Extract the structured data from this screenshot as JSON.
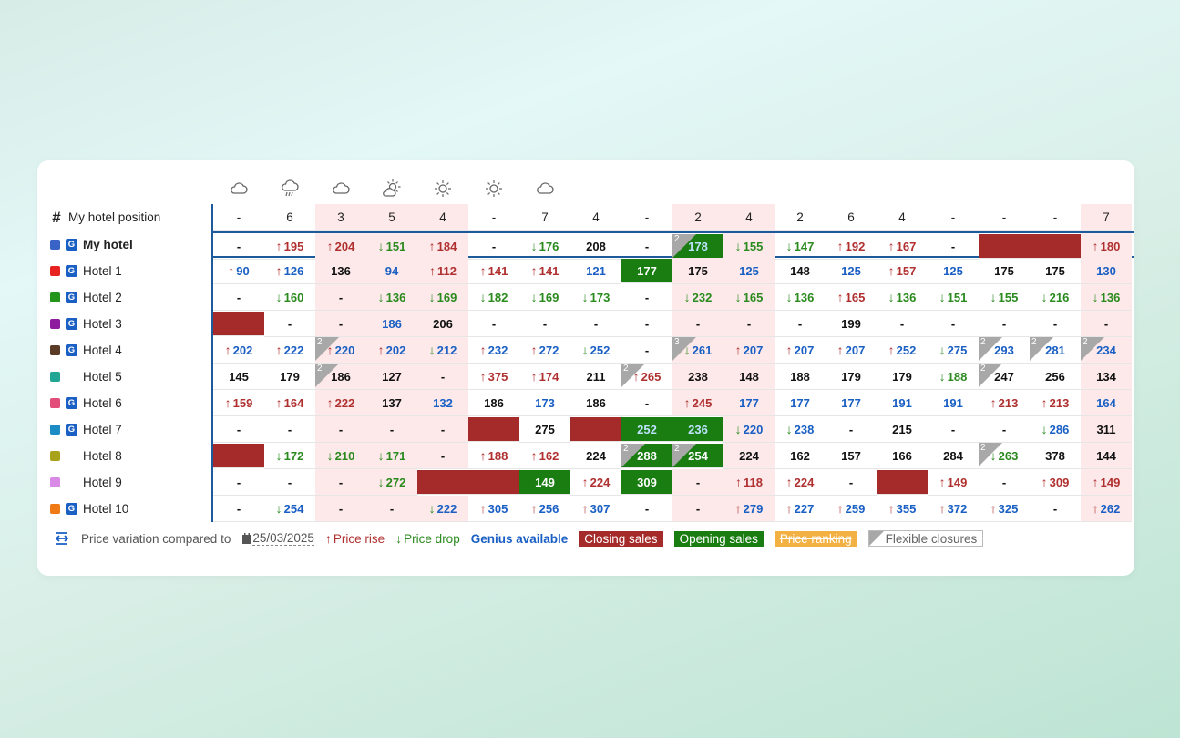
{
  "legend": {
    "compare_label": "Price variation compared to",
    "date": "25/03/2025",
    "rise": "Price rise",
    "drop": "Price drop",
    "genius": "Genius available",
    "closing": "Closing sales",
    "opening": "Opening sales",
    "ranking": "Price ranking",
    "flexible": "Flexible closures"
  },
  "colors": {
    "rise": "#b03030",
    "drop": "#2a8a1e",
    "genius": "#1a5fc4",
    "closing": "#a52a2a",
    "opening": "#1a7d12",
    "ranking": "#f3b143",
    "pink_column": "#fde9e9",
    "flexible": "#a8a8a8"
  },
  "weather": [
    "cloud-icon",
    "rain-icon",
    "cloud-icon",
    "sun-cloud-icon",
    "sun-icon",
    "sun-icon",
    "cloud-icon"
  ],
  "pink_columns": [
    2,
    3,
    4,
    9,
    10,
    17
  ],
  "position_row": {
    "label": "My hotel position",
    "values": [
      "-",
      "6",
      "3",
      "5",
      "4",
      "-",
      "7",
      "4",
      "-",
      "2",
      "4",
      "2",
      "6",
      "4",
      "-",
      "-",
      "-",
      "7"
    ]
  },
  "hotels": [
    {
      "name": "My hotel",
      "color": "#3a63c8",
      "genius": true,
      "bold": true,
      "cells": [
        "-",
        "u195",
        "u204",
        "d151",
        "u184",
        "-",
        "d176",
        "p208",
        "-",
        "F2|O|g178",
        "d155",
        "d147",
        "u192",
        "u167",
        "-",
        "C",
        "C",
        "u180"
      ]
    },
    {
      "name": "Hotel 1",
      "color": "#e82121",
      "genius": true,
      "cells": [
        "ug90",
        "ug126",
        "p136",
        "g94",
        "u112",
        "u141",
        "u141",
        "g121",
        "O|p177",
        "p175",
        "g125",
        "p148",
        "g125",
        "u157",
        "g125",
        "p175",
        "p175",
        "g130"
      ]
    },
    {
      "name": "Hotel 2",
      "color": "#22951a",
      "genius": true,
      "cells": [
        "-",
        "d160",
        "-",
        "d136",
        "d169",
        "d182",
        "d169",
        "d173",
        "-",
        "d232",
        "d165",
        "d136",
        "u165",
        "d136",
        "d151",
        "d155",
        "d216",
        "d136"
      ]
    },
    {
      "name": "Hotel 3",
      "color": "#8e1a9e",
      "genius": true,
      "cells": [
        "C",
        "-",
        "-",
        "g186",
        "p206",
        "-",
        "-",
        "-",
        "-",
        "-",
        "-",
        "-",
        "p199",
        "-",
        "-",
        "-",
        "-",
        "-"
      ]
    },
    {
      "name": "Hotel 4",
      "color": "#5b3a26",
      "genius": true,
      "cells": [
        "ug202",
        "ug222",
        "F2|ug220",
        "ug202",
        "dg212",
        "ug232",
        "ug272",
        "dg252",
        "-",
        "F3|dg261",
        "ug207",
        "ug207",
        "ug207",
        "ug252",
        "dg275",
        "F2|g293",
        "F2|g281",
        "F2|g234"
      ]
    },
    {
      "name": "Hotel 5",
      "color": "#21a595",
      "genius": false,
      "cells": [
        "p145",
        "p179",
        "F2|p186",
        "p127",
        "-",
        "u375",
        "u174",
        "p211",
        "F2|u265",
        "p238",
        "p148",
        "p188",
        "p179",
        "p179",
        "d188",
        "F2|p247",
        "p256",
        "p134"
      ]
    },
    {
      "name": "Hotel 6",
      "color": "#e24d7a",
      "genius": true,
      "cells": [
        "u159",
        "u164",
        "u222",
        "p137",
        "g132",
        "p186",
        "g173",
        "p186",
        "-",
        "u245",
        "g177",
        "g177",
        "g177",
        "g191",
        "g191",
        "u213",
        "u213",
        "g164"
      ]
    },
    {
      "name": "Hotel 7",
      "color": "#1c8cc4",
      "genius": true,
      "cells": [
        "-",
        "-",
        "-",
        "-",
        "-",
        "C",
        "p275",
        "C",
        "O|g252",
        "O|g236",
        "dg220",
        "dg238",
        "-",
        "p215",
        "-",
        "-",
        "dg286",
        "p311"
      ]
    },
    {
      "name": "Hotel 8",
      "color": "#a8a21a",
      "genius": false,
      "cells": [
        "C",
        "d172",
        "d210",
        "d171",
        "-",
        "u188",
        "u162",
        "p224",
        "F2|O|p288",
        "F2|O|p254",
        "p224",
        "p162",
        "p157",
        "p166",
        "p284",
        "F2|d263",
        "p378",
        "p144"
      ]
    },
    {
      "name": "Hotel 9",
      "color": "#d98ae6",
      "genius": false,
      "cells": [
        "-",
        "-",
        "-",
        "d272",
        "C",
        "C",
        "O|p149",
        "u224",
        "O|p309",
        "-",
        "u118",
        "u224",
        "-",
        "C",
        "u149",
        "-",
        "u309",
        "u149"
      ]
    },
    {
      "name": "Hotel 10",
      "color": "#f07a15",
      "genius": true,
      "cells": [
        "-",
        "dg254",
        "-",
        "-",
        "dg222",
        "ug305",
        "ug256",
        "ug307",
        "-",
        "-",
        "ug279",
        "ug227",
        "ug259",
        "ug355",
        "ug372",
        "ug325",
        "-",
        "ug262"
      ]
    }
  ]
}
